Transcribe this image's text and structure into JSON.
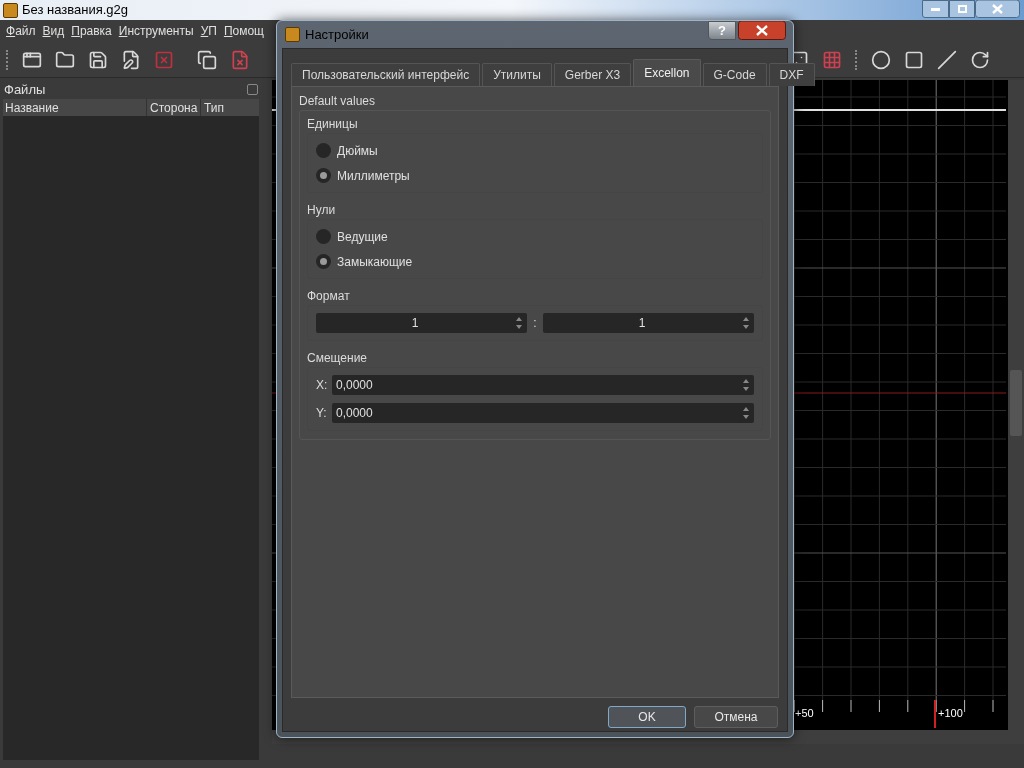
{
  "window": {
    "title": "Без названия.g2g"
  },
  "menu": [
    {
      "label": "Файл"
    },
    {
      "label": "Вид"
    },
    {
      "label": "Правка"
    },
    {
      "label": "Инструменты"
    },
    {
      "label": "УП"
    },
    {
      "label": "Помощ"
    }
  ],
  "files_panel": {
    "title": "Файлы",
    "columns": [
      "Название",
      "Сторона",
      "Тип"
    ]
  },
  "canvas": {
    "axis_labels": [
      "+50",
      "+100"
    ]
  },
  "dialog": {
    "title": "Настройки",
    "help_label": "?",
    "tabs": [
      {
        "label": "Пользовательский интерфейс",
        "selected": false
      },
      {
        "label": "Утилиты",
        "selected": false
      },
      {
        "label": "Gerber X3",
        "selected": false
      },
      {
        "label": "Excellon",
        "selected": true
      },
      {
        "label": "G-Code",
        "selected": false
      },
      {
        "label": "DXF",
        "selected": false
      }
    ],
    "group_title": "Default values",
    "sections": [
      {
        "kind": "radio",
        "title": "Единицы",
        "options": [
          {
            "label": "Дюймы",
            "selected": false
          },
          {
            "label": "Миллиметры",
            "selected": true
          }
        ]
      },
      {
        "kind": "radio",
        "title": "Нули",
        "options": [
          {
            "label": "Ведущие",
            "selected": false
          },
          {
            "label": "Замыкающие",
            "selected": true
          }
        ]
      },
      {
        "kind": "format",
        "title": "Формат",
        "values": [
          "1",
          "1"
        ],
        "separator": ":"
      },
      {
        "kind": "offset",
        "title": "Смещение",
        "fields": [
          {
            "label": "X:",
            "value": "0,0000"
          },
          {
            "label": "Y:",
            "value": "0,0000"
          }
        ]
      }
    ],
    "buttons": [
      {
        "label": "OK",
        "default": true
      },
      {
        "label": "Отмена",
        "default": false
      }
    ]
  }
}
